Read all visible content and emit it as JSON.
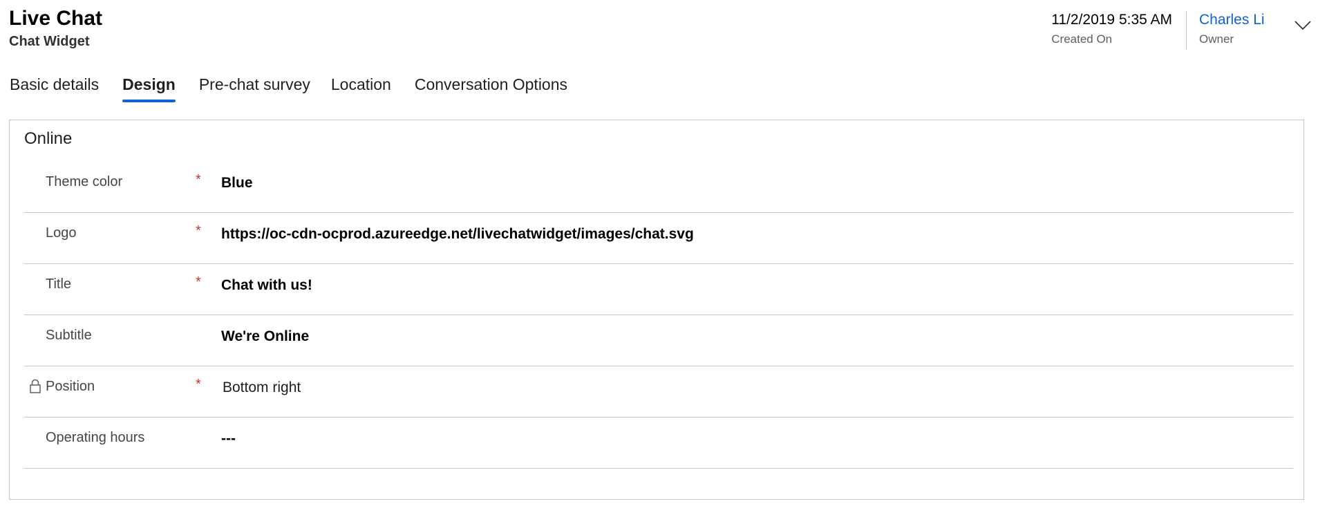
{
  "header": {
    "title": "Live Chat",
    "subtitle": "Chat Widget"
  },
  "meta": {
    "created_on": {
      "value": "11/2/2019 5:35 AM",
      "label": "Created On"
    },
    "owner": {
      "value": "Charles Li",
      "label": "Owner"
    },
    "expand_icon": "chevron-down-icon"
  },
  "tabs": [
    {
      "label": "Basic details",
      "active": false
    },
    {
      "label": "Design",
      "active": true
    },
    {
      "label": "Pre-chat survey",
      "active": false
    },
    {
      "label": "Location",
      "active": false
    },
    {
      "label": "Conversation Options",
      "active": false
    }
  ],
  "section": {
    "title": "Online",
    "fields": [
      {
        "label": "Theme color",
        "required": "*",
        "value": "Blue"
      },
      {
        "label": "Logo",
        "required": "*",
        "value": "https://oc-cdn-ocprod.azureedge.net/livechatwidget/images/chat.svg"
      },
      {
        "label": "Title",
        "required": "*",
        "value": "Chat with us!"
      },
      {
        "label": "Subtitle",
        "required": "",
        "value": "We're Online"
      },
      {
        "label": "Position",
        "required": "*",
        "value": "Bottom right",
        "locked": true,
        "icon": "lock-icon"
      },
      {
        "label": "Operating hours",
        "required": "",
        "value": "---"
      }
    ]
  },
  "colors": {
    "accent": "#0f62d6",
    "required": "#c23934",
    "border": "#c8c6c4"
  }
}
